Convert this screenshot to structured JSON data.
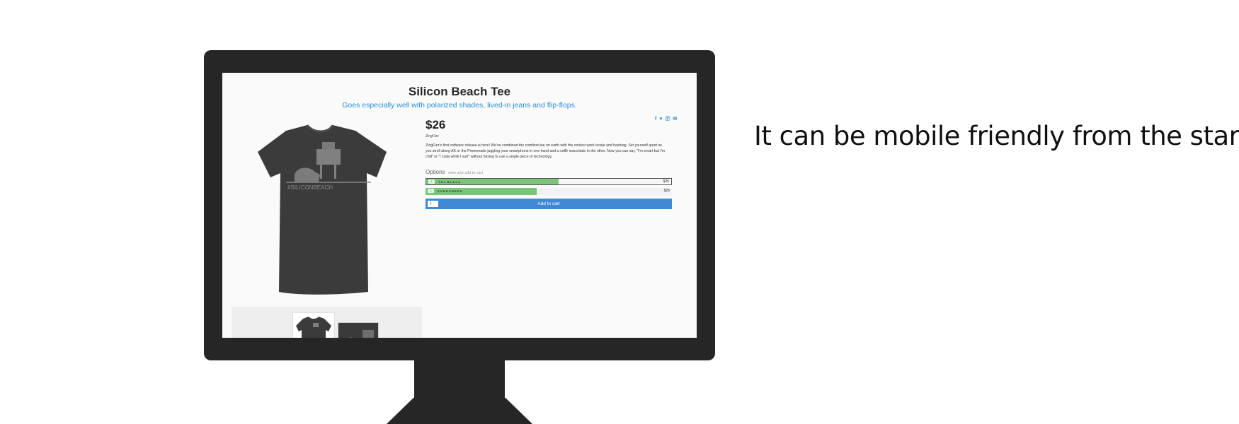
{
  "slide": {
    "tagline": "It can be mobile friendly from the start."
  },
  "store": {
    "title": "Silicon Beach Tee",
    "tagline": "Goes especially well with polarized shades, lived-in jeans and flip-flops.",
    "price": "$26",
    "vendor": "ZingFizz",
    "description": "ZingFizz's first software release is here! We've combined the comfiest tee on earth with the coolest work locale and hashtag. Set yourself apart as you stroll along AK or the Promenade juggling your smartphone in one hand and a caffè macchiato in the other. Now you can say, \"I'm smart but I'm chill\" or \"I code while I surf\" without having to use a single piece of technology.",
    "share_icons": "f ♥ ⓟ ✉",
    "options": {
      "title": "Options",
      "subtitle": "view and add to cart"
    },
    "variants": [
      {
        "label": "TRI-BLACK",
        "price": "$26",
        "qty": "1",
        "stock_fill": 0.54,
        "selected": true
      },
      {
        "label": "EVERGREEN",
        "price": "$26",
        "qty": "1",
        "stock_fill": 0.45,
        "selected": false
      }
    ],
    "cart": {
      "qty": "1",
      "label": "Add to cart"
    },
    "shirt_print": "#SILICONBEACH"
  },
  "colors": {
    "accent": "#3e88d4",
    "tagline": "#2b8fd6",
    "stock_bar": "#7ac57a",
    "bezel": "#262626"
  }
}
